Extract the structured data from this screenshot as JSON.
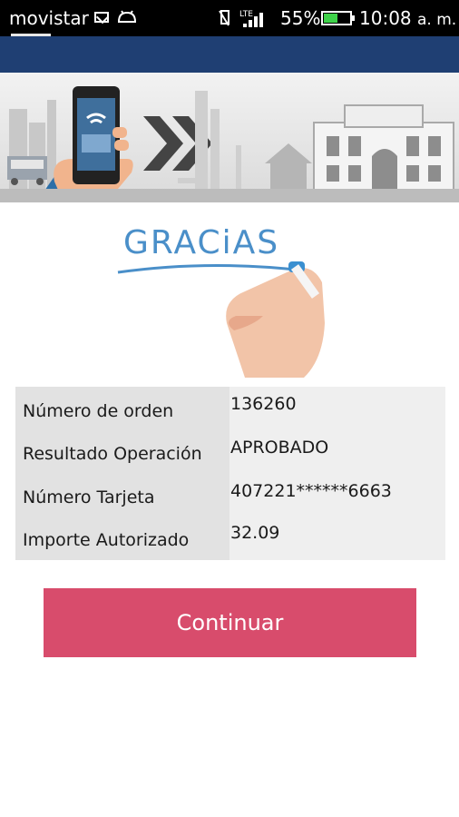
{
  "status_bar": {
    "carrier": "movistar",
    "network": "LTE",
    "battery_percent": "55%",
    "battery_level": 0.55,
    "time": "10:08",
    "time_suffix": "a. m."
  },
  "thanks": {
    "text": "GRACiAS"
  },
  "result": {
    "rows": [
      {
        "label": "Número de orden",
        "value": "136260"
      },
      {
        "label": "Resultado Operación",
        "value": "APROBADO"
      },
      {
        "label": "Número Tarjeta",
        "value": "407221******6663"
      },
      {
        "label": "Importe Autorizado",
        "value": "32.09"
      }
    ]
  },
  "actions": {
    "continue_label": "Continuar"
  },
  "colors": {
    "status_bar": "#000000",
    "app_bar": "#1f3f73",
    "button": "#d84c6c",
    "thanks_text": "#4a8fc9"
  }
}
